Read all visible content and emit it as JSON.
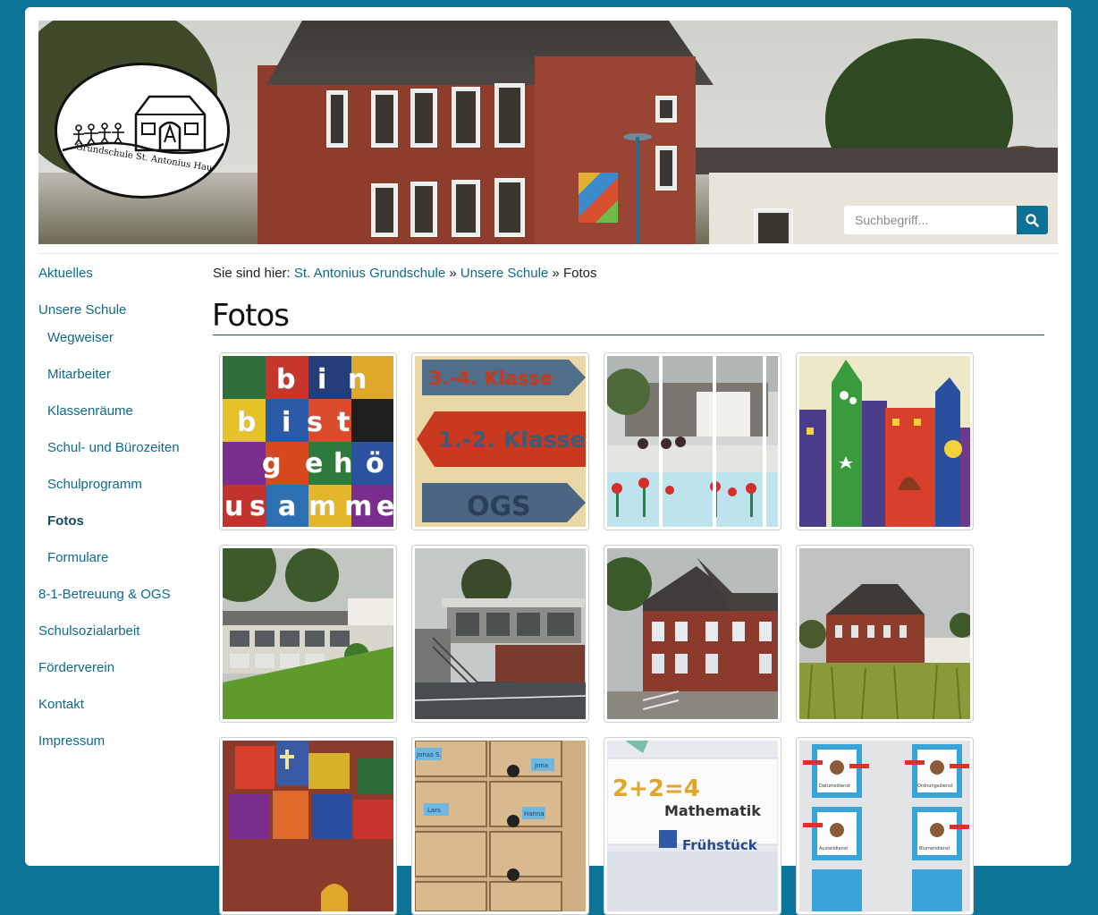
{
  "header": {
    "logo_text": "Grundschule St. Antonius Hau",
    "search_placeholder": "Suchbegriff..."
  },
  "sidebar": {
    "items": [
      {
        "label": "Aktuelles",
        "level": 0,
        "active": false
      },
      {
        "label": "Unsere Schule",
        "level": 0,
        "active": false
      },
      {
        "label": "Wegweiser",
        "level": 1,
        "active": false
      },
      {
        "label": "Mitarbeiter",
        "level": 1,
        "active": false
      },
      {
        "label": "Klassenräume",
        "level": 1,
        "active": false
      },
      {
        "label": "Schul- und Bürozeiten",
        "level": 1,
        "active": false
      },
      {
        "label": "Schulprogramm",
        "level": 1,
        "active": false
      },
      {
        "label": "Fotos",
        "level": 1,
        "active": true
      },
      {
        "label": "Formulare",
        "level": 1,
        "active": false
      },
      {
        "label": "8-1-Betreuung & OGS",
        "level": 0,
        "active": false
      },
      {
        "label": "Schulsozialarbeit",
        "level": 0,
        "active": false
      },
      {
        "label": "Förderverein",
        "level": 0,
        "active": false
      },
      {
        "label": "Kontakt",
        "level": 0,
        "active": false
      },
      {
        "label": "Impressum",
        "level": 0,
        "active": false
      }
    ]
  },
  "breadcrumb": {
    "prefix": "Sie sind hier:",
    "links": [
      "St. Antonius Grundschule",
      "Unsere Schule"
    ],
    "separator": "»",
    "current": "Fotos"
  },
  "main": {
    "title": "Fotos"
  },
  "gallery": {
    "photos": [
      {
        "subject": "colorful-letter-tiles-artwork"
      },
      {
        "subject": "class-direction-signs"
      },
      {
        "subject": "window-flower-painting"
      },
      {
        "subject": "painted-monster-houses"
      },
      {
        "subject": "school-building-with-lawn"
      },
      {
        "subject": "school-building-modern-stairs"
      },
      {
        "subject": "brick-school-building"
      },
      {
        "subject": "brick-school-with-cornfield"
      },
      {
        "subject": "quilt-artwork-on-brick-wall"
      },
      {
        "subject": "wooden-drawers-with-names"
      },
      {
        "subject": "math-poster"
      },
      {
        "subject": "picture-cards-on-wall"
      }
    ],
    "sign_texts": [
      "3.-4. Klasse",
      "1.-2. Klasse",
      "OGS"
    ],
    "tile_letters": [
      "b",
      "i",
      "n",
      "b",
      "i",
      "s",
      "t",
      "g",
      "e",
      "h",
      "ö",
      "u",
      "s",
      "a",
      "m",
      "m",
      "e"
    ],
    "math_texts": [
      "2+2=4",
      "Mathematik",
      "Frühstück"
    ],
    "drawer_labels": [
      "Jonas S.",
      "Lars",
      "Jona",
      "Hanna"
    ],
    "card_labels": [
      "Datumsdienst",
      "Ordnungsdienst",
      "Austeildienst",
      "Blumendienst"
    ]
  },
  "colors": {
    "brand": "#0e7497",
    "link": "#0e6a8c",
    "title_rule": "#124e66"
  }
}
